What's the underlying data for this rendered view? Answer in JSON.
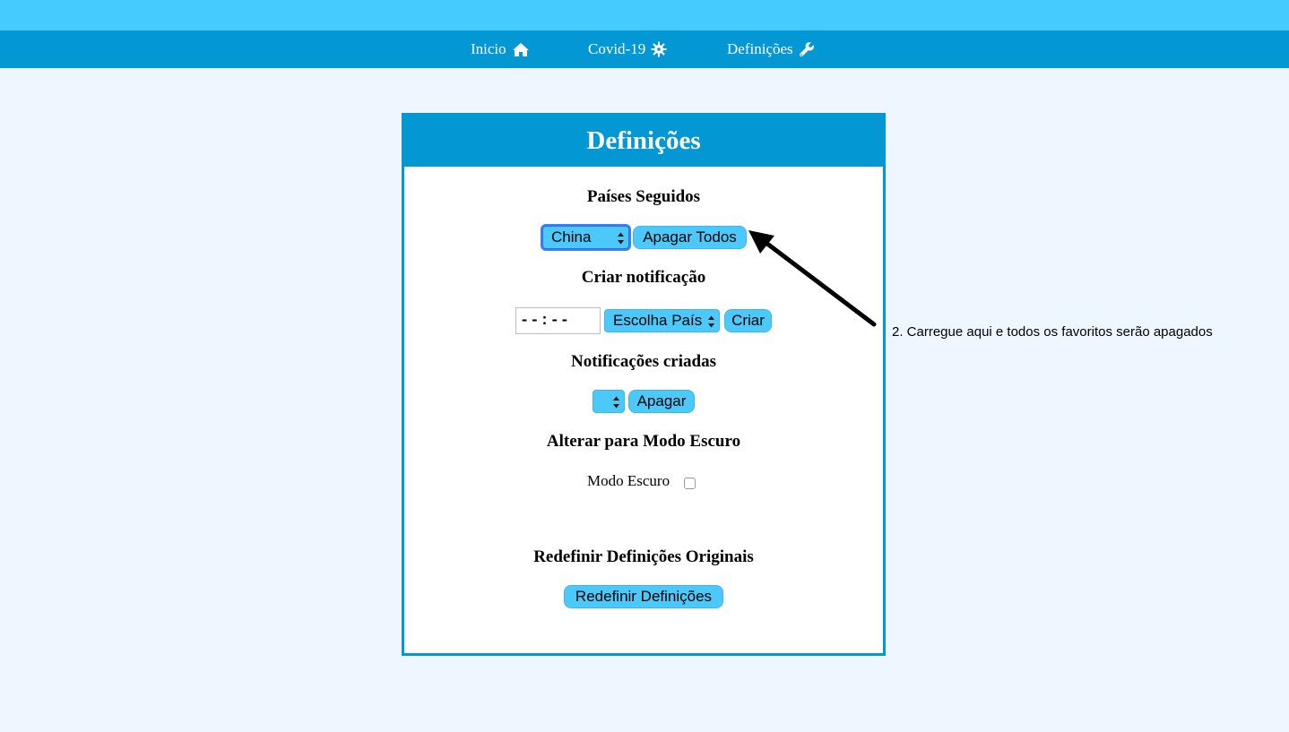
{
  "nav": {
    "items": [
      {
        "label": "Inicio",
        "icon": "home-icon"
      },
      {
        "label": "Covid-19",
        "icon": "virus-icon"
      },
      {
        "label": "Definições",
        "icon": "wrench-icon"
      }
    ]
  },
  "panel": {
    "title": "Definições",
    "sections": {
      "followed": {
        "heading": "Países Seguidos",
        "select_value": "China",
        "button": "Apagar Todos"
      },
      "create_notification": {
        "heading": "Criar notificação",
        "time_value": "--:--",
        "country_select": "Escolha País",
        "button": "Criar"
      },
      "created_notifications": {
        "heading": "Notificações criadas",
        "select_value": "",
        "button": "Apagar"
      },
      "dark_mode": {
        "heading": "Alterar para Modo Escuro",
        "label": "Modo Escuro",
        "checked": false
      },
      "reset": {
        "heading": "Redefinir Definições Originais",
        "button": "Redefinir Definições"
      }
    }
  },
  "annotation": {
    "text": "2. Carregue aqui e todos os favoritos serão apagados"
  },
  "colors": {
    "top_bar": "#46cbff",
    "nav_bar": "#0398d4",
    "page_bg": "#eef7ff",
    "control_blue": "#4cc9fb"
  }
}
